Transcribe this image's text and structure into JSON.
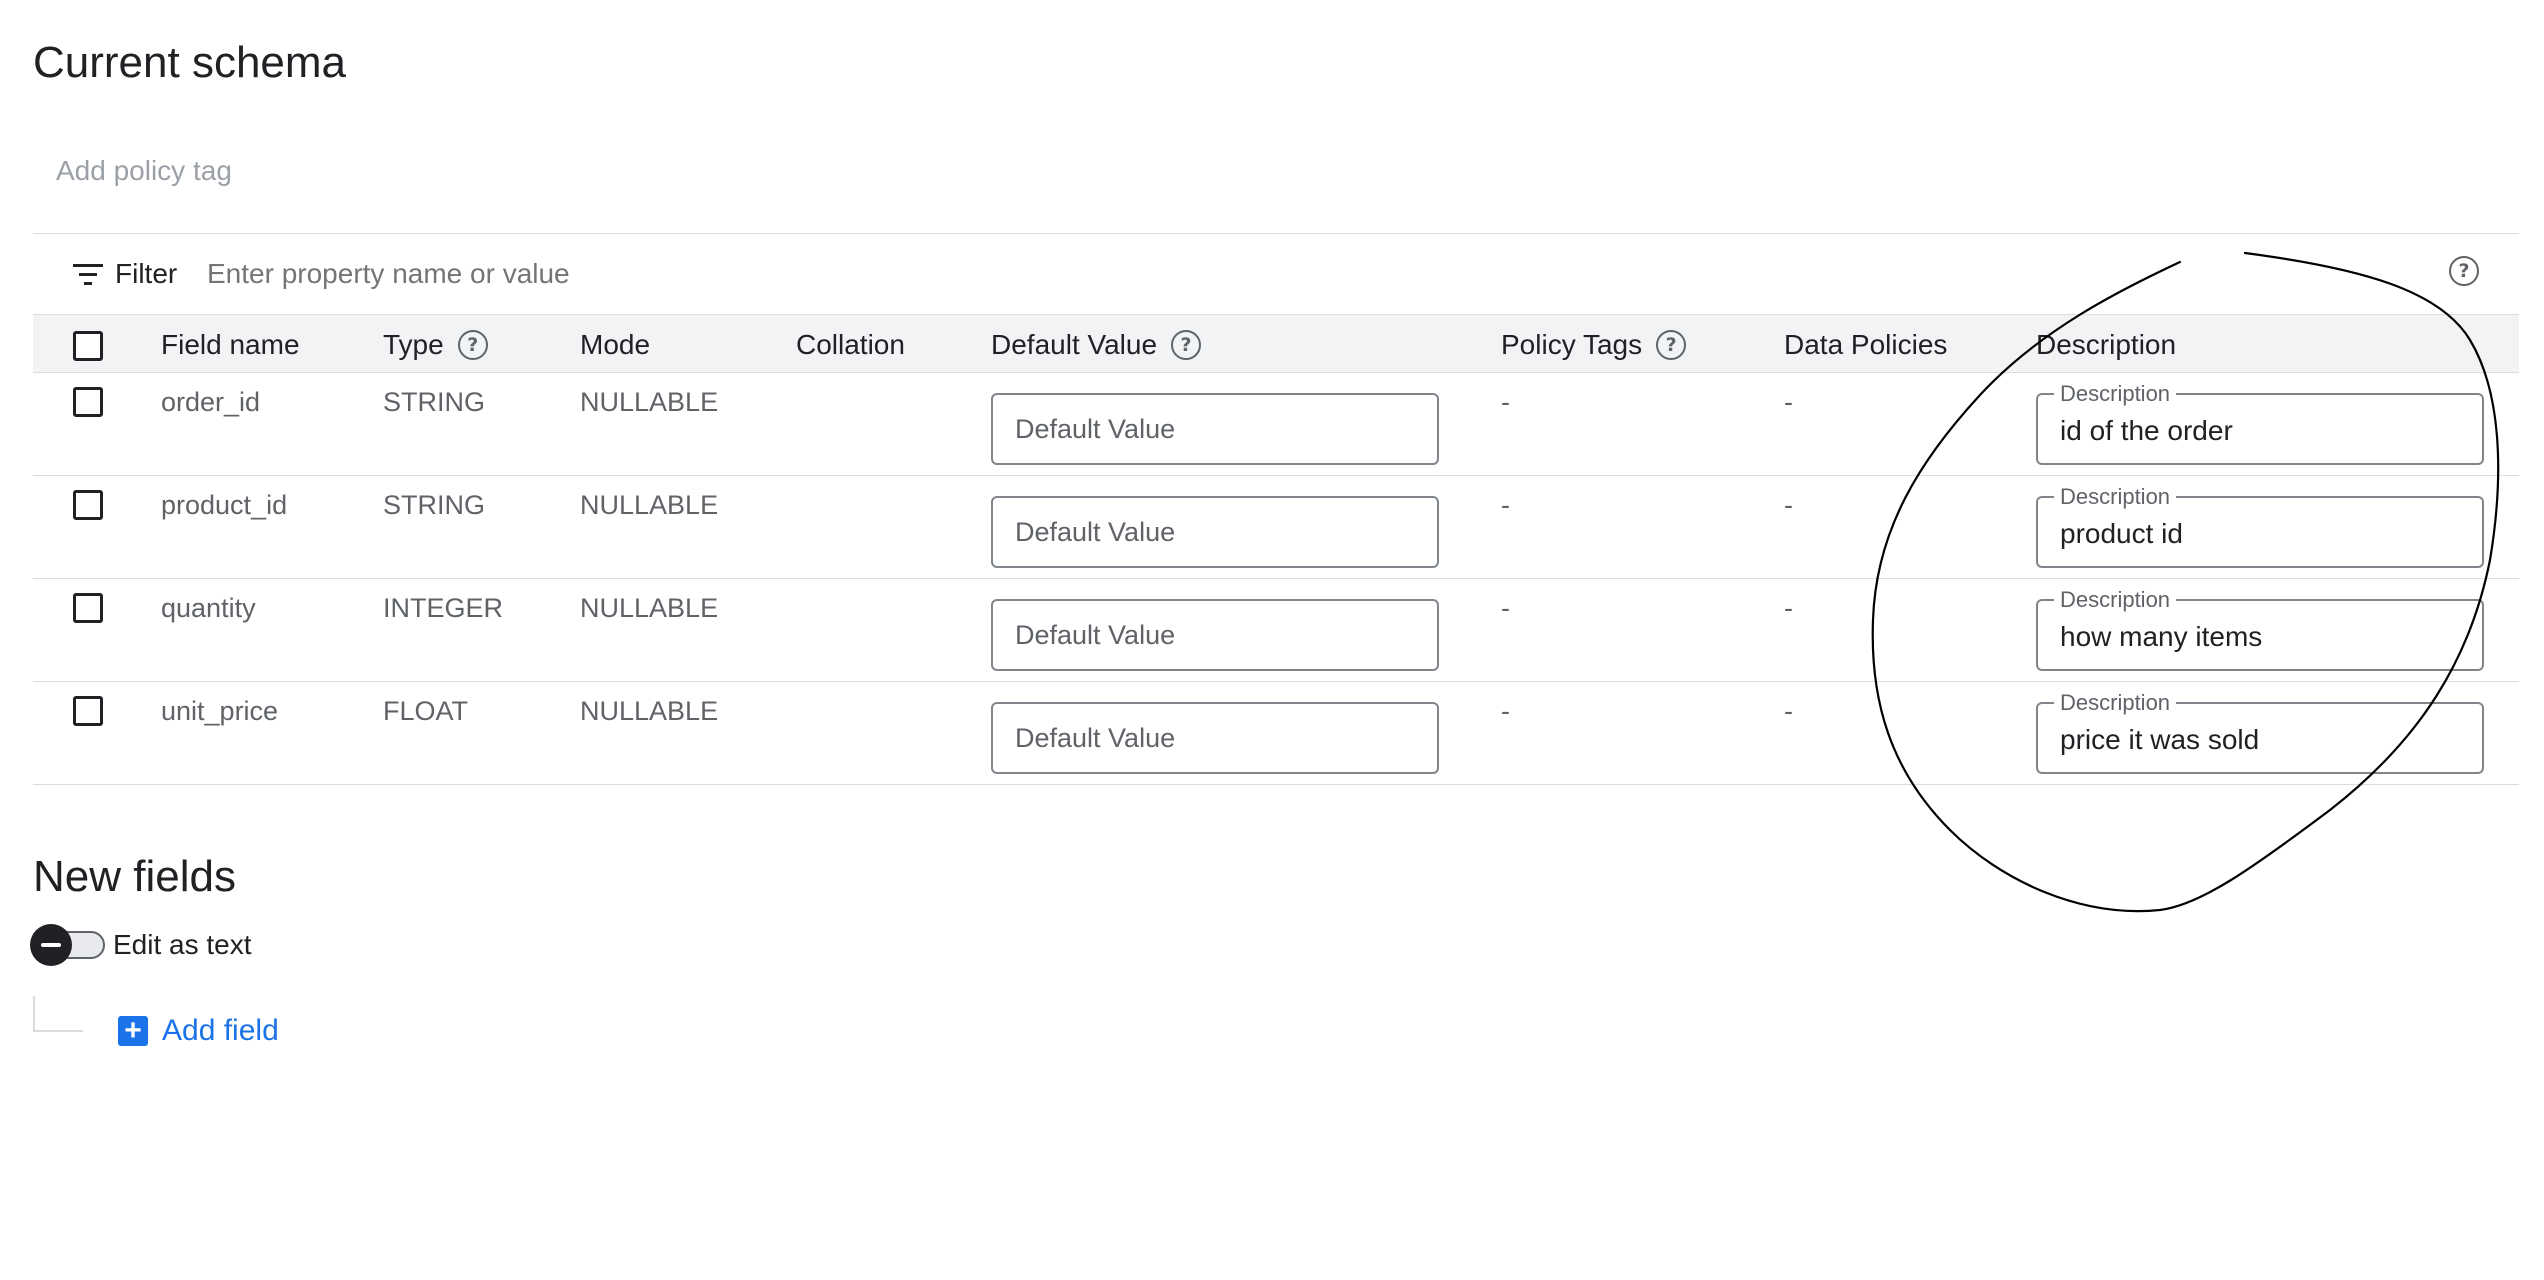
{
  "page": {
    "title": "Current schema",
    "policy_tag_label": "Add policy tag"
  },
  "filter": {
    "label": "Filter",
    "placeholder": "Enter property name or value"
  },
  "columns": {
    "field_name": "Field name",
    "type": "Type",
    "mode": "Mode",
    "collation": "Collation",
    "default_value": "Default Value",
    "policy_tags": "Policy Tags",
    "data_policies": "Data Policies",
    "description": "Description"
  },
  "rows": [
    {
      "field_name": "order_id",
      "type": "STRING",
      "mode": "NULLABLE",
      "default_placeholder": "Default Value",
      "policy_tags": "-",
      "data_policies": "-",
      "description_label": "Description",
      "description": "id of the order"
    },
    {
      "field_name": "product_id",
      "type": "STRING",
      "mode": "NULLABLE",
      "default_placeholder": "Default Value",
      "policy_tags": "-",
      "data_policies": "-",
      "description_label": "Description",
      "description": "product id"
    },
    {
      "field_name": "quantity",
      "type": "INTEGER",
      "mode": "NULLABLE",
      "default_placeholder": "Default Value",
      "policy_tags": "-",
      "data_policies": "-",
      "description_label": "Description",
      "description": "how many items"
    },
    {
      "field_name": "unit_price",
      "type": "FLOAT",
      "mode": "NULLABLE",
      "default_placeholder": "Default Value",
      "policy_tags": "-",
      "data_policies": "-",
      "description_label": "Description",
      "description": "price it was sold"
    }
  ],
  "new_fields": {
    "title": "New fields",
    "edit_as_text_label": "Edit as text",
    "add_field_label": "Add field"
  },
  "icons": {
    "filter": "filter-icon",
    "help": "help-circle-icon",
    "add": "add-box-icon"
  },
  "colors": {
    "accent": "#1a73e8",
    "annotation": "#000000"
  }
}
